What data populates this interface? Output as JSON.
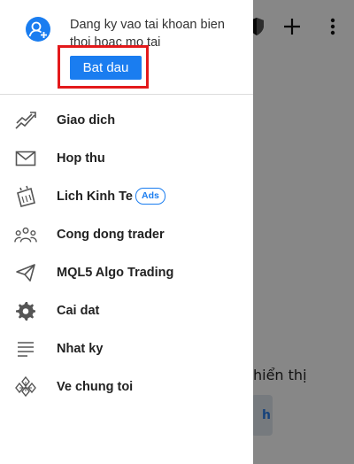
{
  "background": {
    "toolbar": {
      "shield_icon": "shield-icon",
      "add_icon": "plus-icon",
      "more_icon": "more-vertical-icon"
    },
    "empty_state_text": "hiển thị",
    "action_button_label": "h"
  },
  "drawer": {
    "signup": {
      "avatar_icon": "add-user-icon",
      "prompt": "Dang ky vao tai khoan bien thoi hoac mo tai",
      "start_button": "Bat dau"
    },
    "menu": [
      {
        "icon": "trade-chart-icon",
        "label": "Giao dich"
      },
      {
        "icon": "mail-icon",
        "label": "Hop thu"
      },
      {
        "icon": "calendar-icon",
        "label": "Lich Kinh Te",
        "badge": "Ads"
      },
      {
        "icon": "community-icon",
        "label": "Cong dong trader"
      },
      {
        "icon": "send-icon",
        "label": "MQL5 Algo Trading"
      },
      {
        "icon": "gear-icon",
        "label": "Cai dat"
      },
      {
        "icon": "journal-icon",
        "label": "Nhat ky"
      },
      {
        "icon": "about-logo-icon",
        "label": "Ve chung toi"
      }
    ]
  },
  "colors": {
    "accent": "#1a7df0",
    "highlight": "#e3191b",
    "scrim": "rgba(0,0,0,0.47)"
  }
}
